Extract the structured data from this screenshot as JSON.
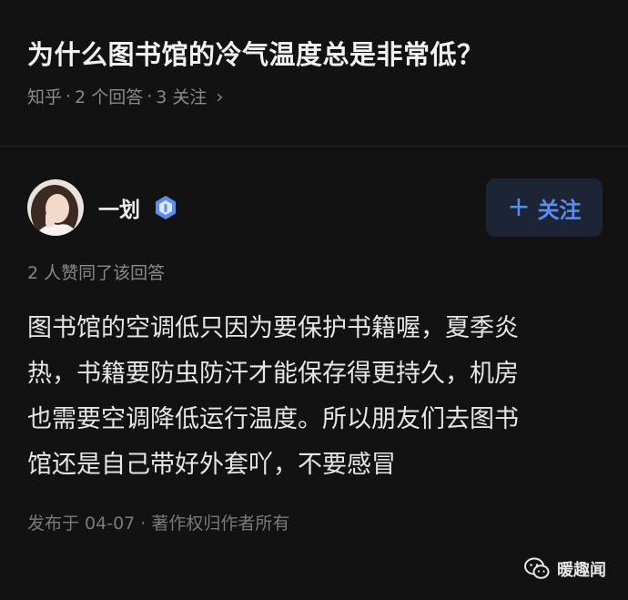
{
  "question": {
    "title": "为什么图书馆的冷气温度总是非常低？",
    "source": "知乎",
    "sep": "·",
    "answers": "2 个回答",
    "followers": "3 关注",
    "chevron": "›"
  },
  "author": {
    "name": "一划",
    "badge_icon": "verified-badge-icon"
  },
  "follow_button": {
    "icon": "+",
    "label": "关注"
  },
  "likes": "2 人赞同了该回答",
  "answer_lines": [
    "图书馆的空调低只因为要保护书籍喔，夏季炎",
    "热，书籍要防虫防汗才能保存得更持久，机房",
    "也需要空调降低运行温度。所以朋友们去图书",
    "馆还是自己带好外套吖，不要感冒"
  ],
  "footer": "发布于 04-07 · 著作权归作者所有",
  "watermark": {
    "icon": "wechat-icon",
    "text": "暖趣闻"
  },
  "colors": {
    "background": "#121212",
    "accent": "#5b8ef0",
    "follow_bg": "#1c2535",
    "muted": "#8a8a8a"
  }
}
